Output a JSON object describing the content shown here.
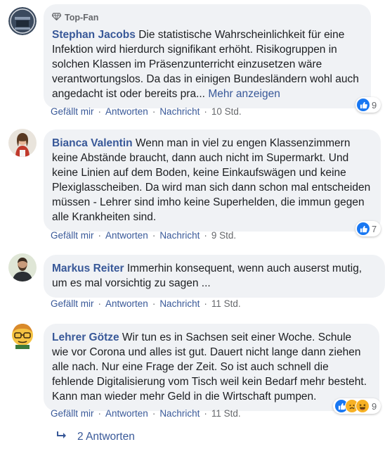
{
  "comments": [
    {
      "badge": "Top-Fan",
      "author": "Stephan Jacobs",
      "text": "Die statistische Wahrscheinlichkeit für eine Infektion wird hierdurch signifikant erhöht. Risikogruppen in solchen Klassen im Präsenzunterricht einzusetzen wäre verantwortungslos. Da das in einigen Bundesländern wohl auch angedacht ist oder bereits pra...",
      "more": "Mehr anzeigen",
      "like": "Gefällt mir",
      "reply": "Antworten",
      "message": "Nachricht",
      "time": "10 Std.",
      "reaction_count": "9",
      "reactions": [
        "like-icon"
      ]
    },
    {
      "author": "Bianca Valentin",
      "text": "Wenn man in viel zu engen Klassenzimmern keine Abstände braucht, dann auch nicht im Supermarkt. Und keine Linien auf dem Boden, keine Einkaufswägen und keine Plexiglasscheiben. Da wird man sich dann schon mal entscheiden müssen - Lehrer sind imho keine Superhelden, die immun gegen alle Krankheiten sind.",
      "like": "Gefällt mir",
      "reply": "Antworten",
      "message": "Nachricht",
      "time": "9 Std.",
      "reaction_count": "7",
      "reactions": [
        "like-icon"
      ]
    },
    {
      "author": "Markus Reiter",
      "text": "Immerhin konsequent, wenn auch auserst mutig, um es mal vorsichtig zu sagen ...",
      "like": "Gefällt mir",
      "reply": "Antworten",
      "message": "Nachricht",
      "time": "11 Std."
    },
    {
      "author": "Lehrer Götze",
      "text": "Wir tun es in Sachsen seit einer Woche. Schule wie vor Corona und alles ist gut. Dauert nicht lange dann ziehen alle nach. Nur eine Frage der Zeit. So ist auch schnell die fehlende Digitalisierung vom Tisch weil kein Bedarf mehr besteht. Kann man wieder mehr Geld in die Wirtschaft pumpen.",
      "like": "Gefällt mir",
      "reply": "Antworten",
      "message": "Nachricht",
      "time": "11 Std.",
      "reaction_count": "9",
      "reactions": [
        "like-icon",
        "sad-icon",
        "haha-icon"
      ]
    }
  ],
  "replies_link": "2 Antworten",
  "colors": {
    "link": "#385898",
    "bubble": "#f0f2f5",
    "meta": "#65676b",
    "like": "#1877f2"
  }
}
